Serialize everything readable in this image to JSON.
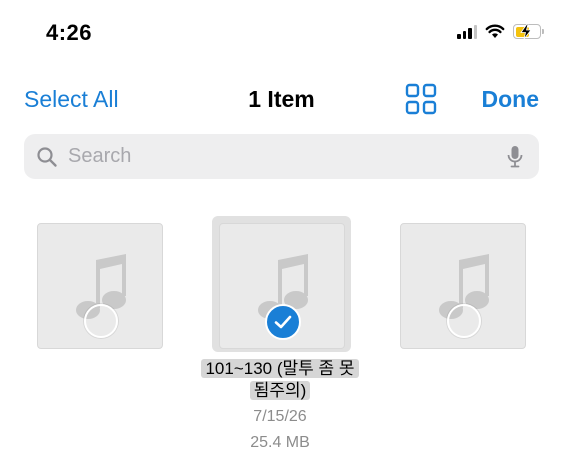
{
  "status": {
    "time": "4:26"
  },
  "nav": {
    "select_all": "Select All",
    "title": "1 Item",
    "done": "Done"
  },
  "search": {
    "placeholder": "Search"
  },
  "items": [
    {
      "selected": false
    },
    {
      "selected": true,
      "name_line1": "101~130 (말투 좀 못",
      "name_line2": "됨주의)",
      "date": "7/15/26",
      "size": "25.4 MB"
    },
    {
      "selected": false
    }
  ],
  "colors": {
    "accent": "#1a7fd6",
    "battery_charging": "#f4c20d",
    "tile_bg": "#eaeaea"
  }
}
